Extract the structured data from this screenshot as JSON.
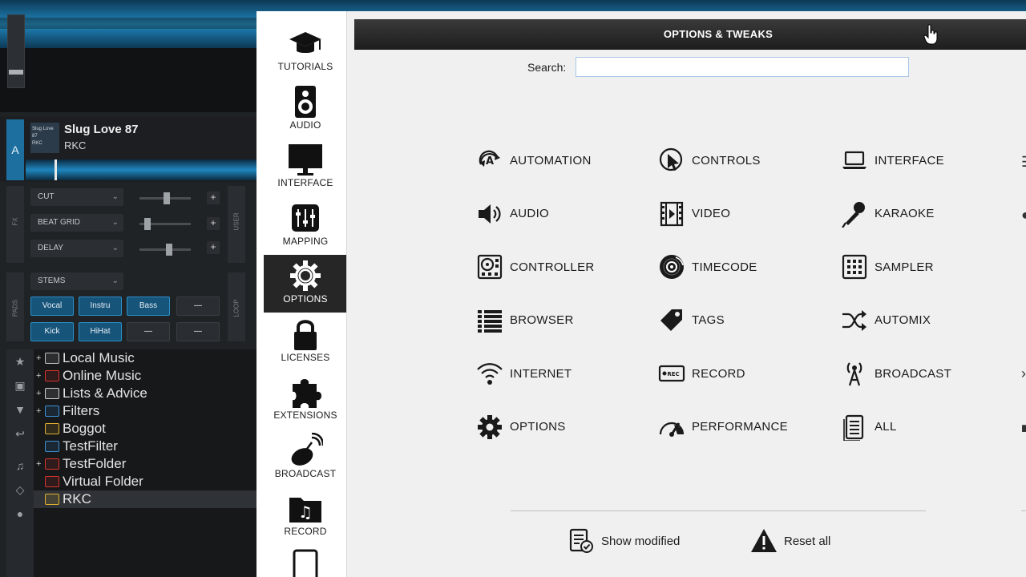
{
  "background_app": {
    "deck": {
      "letter": "A",
      "cover_text": "Slug Love 87\nRKC",
      "title": "Slug Love 87",
      "artist": "RKC"
    },
    "fx": {
      "side_label": "FX",
      "user_label": "USER",
      "effects": [
        "CUT",
        "BEAT GRID",
        "DELAY"
      ]
    },
    "pads": {
      "side_label": "PADS",
      "loop_label": "LOOP",
      "mode": "STEMS",
      "row1": [
        "Vocal",
        "Instru",
        "Bass",
        "—"
      ],
      "row2": [
        "Kick",
        "HiHat",
        "—",
        "—"
      ]
    },
    "tree": [
      {
        "label": "Local Music",
        "expandable": true,
        "icon": "computer-icon",
        "color": "#bfbfbf"
      },
      {
        "label": "Online Music",
        "expandable": true,
        "icon": "globe-icon",
        "color": "#d9332b"
      },
      {
        "label": "Lists & Advice",
        "expandable": true,
        "icon": "list-icon",
        "color": "#cfcfcf"
      },
      {
        "label": "Filters",
        "expandable": true,
        "icon": "filter-folder-icon",
        "color": "#3c8fd6"
      },
      {
        "label": "Boggot",
        "expandable": false,
        "icon": "star-folder-icon",
        "color": "#e0b030"
      },
      {
        "label": "TestFilter",
        "expandable": false,
        "icon": "filter-folder-icon",
        "color": "#3c8fd6"
      },
      {
        "label": "TestFolder",
        "expandable": true,
        "icon": "music-folder-icon",
        "color": "#d9332b"
      },
      {
        "label": "Virtual Folder",
        "expandable": false,
        "icon": "music-folder-icon",
        "color": "#d9332b"
      },
      {
        "label": "RKC",
        "expandable": false,
        "icon": "star-folder-icon",
        "color": "#e0b030",
        "selected": true
      }
    ]
  },
  "nav": {
    "items": [
      {
        "label": "TUTORIALS",
        "icon": "graduation-cap-icon",
        "active": false
      },
      {
        "label": "AUDIO",
        "icon": "speaker-icon",
        "active": false
      },
      {
        "label": "INTERFACE",
        "icon": "monitor-icon",
        "active": false
      },
      {
        "label": "MAPPING",
        "icon": "mixer-icon",
        "active": false
      },
      {
        "label": "OPTIONS",
        "icon": "gear-icon",
        "active": true
      },
      {
        "label": "LICENSES",
        "icon": "lock-icon",
        "active": false
      },
      {
        "label": "EXTENSIONS",
        "icon": "puzzle-icon",
        "active": false
      },
      {
        "label": "BROADCAST",
        "icon": "satellite-dish-icon",
        "active": false
      },
      {
        "label": "RECORD",
        "icon": "music-folder-icon",
        "active": false
      },
      {
        "label": "",
        "icon": "tablet-icon",
        "active": false
      }
    ]
  },
  "header": {
    "title": "OPTIONS & TWEAKS"
  },
  "search": {
    "label": "Search:",
    "value": "",
    "placeholder": ""
  },
  "categories": [
    {
      "label": "AUTOMATION",
      "icon": "automation-icon"
    },
    {
      "label": "CONTROLS",
      "icon": "cursor-click-icon"
    },
    {
      "label": "INTERFACE",
      "icon": "laptop-icon"
    },
    {
      "label": "AUDIO",
      "icon": "volume-icon"
    },
    {
      "label": "VIDEO",
      "icon": "film-icon"
    },
    {
      "label": "KARAOKE",
      "icon": "microphone-icon"
    },
    {
      "label": "CONTROLLER",
      "icon": "controller-icon"
    },
    {
      "label": "TIMECODE",
      "icon": "vinyl-icon"
    },
    {
      "label": "SAMPLER",
      "icon": "sampler-grid-icon"
    },
    {
      "label": "BROWSER",
      "icon": "list-icon"
    },
    {
      "label": "TAGS",
      "icon": "tag-icon"
    },
    {
      "label": "AUTOMIX",
      "icon": "shuffle-icon"
    },
    {
      "label": "INTERNET",
      "icon": "wifi-icon"
    },
    {
      "label": "RECORD",
      "icon": "rec-icon"
    },
    {
      "label": "BROADCAST",
      "icon": "antenna-icon"
    },
    {
      "label": "OPTIONS",
      "icon": "gear-icon"
    },
    {
      "label": "PERFORMANCE",
      "icon": "gauge-icon"
    },
    {
      "label": "ALL",
      "icon": "document-icon"
    }
  ],
  "footer": {
    "show_modified": "Show modified",
    "reset_all": "Reset all"
  },
  "colors": {
    "panel_bg": "#f0f0f0",
    "header_bg": "#262626",
    "active_nav_bg": "#262626",
    "accent_blue": "#1d6fa0"
  }
}
